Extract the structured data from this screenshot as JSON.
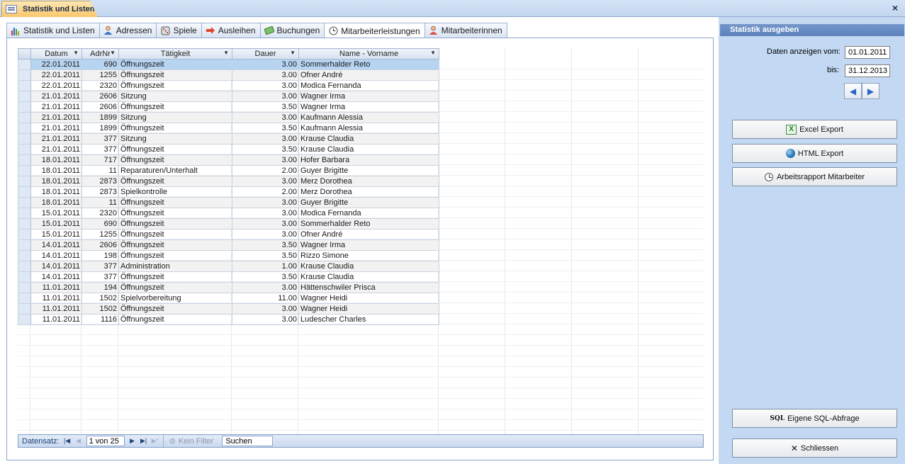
{
  "window": {
    "title": "Statistik und Listen",
    "close_glyph": "×"
  },
  "tabs": [
    {
      "label": "Statistik und Listen",
      "icon": "bar-chart-icon"
    },
    {
      "label": "Adressen",
      "icon": "person-icon"
    },
    {
      "label": "Spiele",
      "icon": "dice-icon"
    },
    {
      "label": "Ausleihen",
      "icon": "arrow-right-icon"
    },
    {
      "label": "Buchungen",
      "icon": "money-icon"
    },
    {
      "label": "Mitarbeiterleistungen",
      "icon": "clock-icon"
    },
    {
      "label": "Mitarbeiterinnen",
      "icon": "person-female-icon"
    }
  ],
  "active_tab": "Mitarbeiterleistungen",
  "grid": {
    "columns": [
      "Datum",
      "AdrNr",
      "Tätigkeit",
      "Dauer",
      "Name - Vorname"
    ],
    "rows": [
      [
        "22.01.2011",
        "690",
        "Öffnungszeit",
        "3.00",
        "Sommerhalder Reto"
      ],
      [
        "22.01.2011",
        "1255",
        "Öffnungszeit",
        "3.00",
        "Ofner André"
      ],
      [
        "22.01.2011",
        "2320",
        "Öffnungszeit",
        "3.00",
        "Modica Fernanda"
      ],
      [
        "21.01.2011",
        "2606",
        "Sitzung",
        "3.00",
        "Wagner Irma"
      ],
      [
        "21.01.2011",
        "2606",
        "Öffnungszeit",
        "3.50",
        "Wagner Irma"
      ],
      [
        "21.01.2011",
        "1899",
        "Sitzung",
        "3.00",
        "Kaufmann Alessia"
      ],
      [
        "21.01.2011",
        "1899",
        "Öffnungszeit",
        "3.50",
        "Kaufmann Alessia"
      ],
      [
        "21.01.2011",
        "377",
        "Sitzung",
        "3.00",
        "Krause Claudia"
      ],
      [
        "21.01.2011",
        "377",
        "Öffnungszeit",
        "3.50",
        "Krause Claudia"
      ],
      [
        "18.01.2011",
        "717",
        "Öffnungszeit",
        "3.00",
        "Hofer Barbara"
      ],
      [
        "18.01.2011",
        "11",
        "Reparaturen/Unterhalt",
        "2.00",
        "Guyer Brigitte"
      ],
      [
        "18.01.2011",
        "2873",
        "Öffnungszeit",
        "3.00",
        "Merz Dorothea"
      ],
      [
        "18.01.2011",
        "2873",
        "Spielkontrolle",
        "2.00",
        "Merz Dorothea"
      ],
      [
        "18.01.2011",
        "11",
        "Öffnungszeit",
        "3.00",
        "Guyer Brigitte"
      ],
      [
        "15.01.2011",
        "2320",
        "Öffnungszeit",
        "3.00",
        "Modica Fernanda"
      ],
      [
        "15.01.2011",
        "690",
        "Öffnungszeit",
        "3.00",
        "Sommerhalder Reto"
      ],
      [
        "15.01.2011",
        "1255",
        "Öffnungszeit",
        "3.00",
        "Ofner André"
      ],
      [
        "14.01.2011",
        "2606",
        "Öffnungszeit",
        "3.50",
        "Wagner Irma"
      ],
      [
        "14.01.2011",
        "198",
        "Öffnungszeit",
        "3.50",
        "Rizzo Simone"
      ],
      [
        "14.01.2011",
        "377",
        "Administration",
        "1.00",
        "Krause Claudia"
      ],
      [
        "14.01.2011",
        "377",
        "Öffnungszeit",
        "3.50",
        "Krause Claudia"
      ],
      [
        "11.01.2011",
        "194",
        "Öffnungszeit",
        "3.00",
        "Hättenschwiler Prisca"
      ],
      [
        "11.01.2011",
        "1502",
        "Spielvorbereitung",
        "11.00",
        "Wagner Heidi"
      ],
      [
        "11.01.2011",
        "1502",
        "Öffnungszeit",
        "3.00",
        "Wagner Heidi"
      ],
      [
        "11.01.2011",
        "1116",
        "Öffnungszeit",
        "3.00",
        "Ludescher Charles"
      ]
    ]
  },
  "navbar": {
    "label": "Datensatz:",
    "record_value": "1 von 25",
    "filter_label": "Kein Filter",
    "search_placeholder": "Suchen"
  },
  "side": {
    "header": "Statistik ausgeben",
    "from_label": "Daten anzeigen vom:",
    "from_value": "01.01.2011",
    "to_label": "bis:",
    "to_value": "31.12.2013",
    "prev_glyph": "◀",
    "next_glyph": "▶",
    "buttons": {
      "excel": "Excel Export",
      "html": "HTML Export",
      "rapport": "Arbeitsrapport Mitarbeiter",
      "sql": "Eigene SQL-Abfrage",
      "close": "Schliessen"
    },
    "sql_tag": "SQL",
    "excel_tag": "X"
  }
}
